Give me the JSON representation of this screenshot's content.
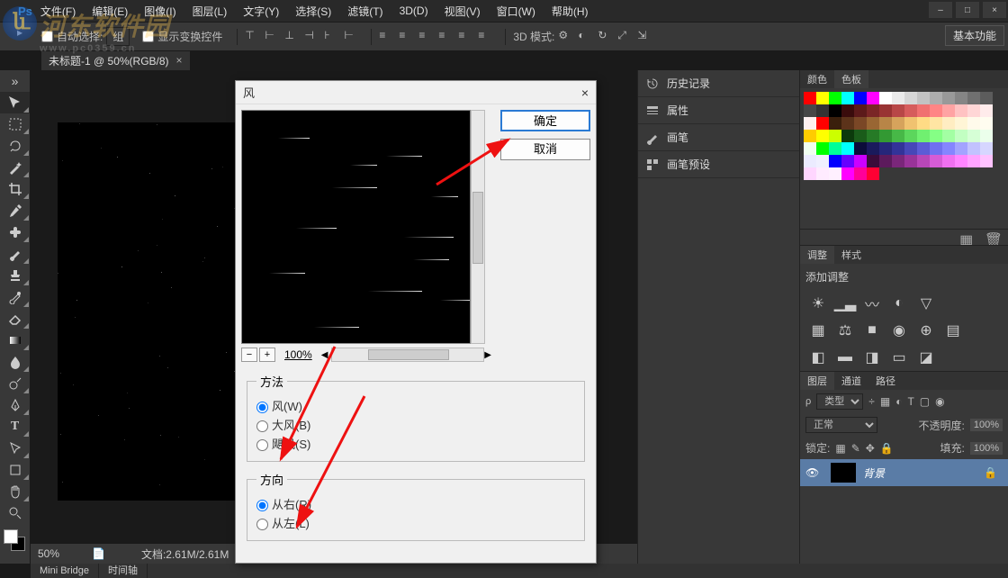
{
  "menu": {
    "items": [
      "文件(F)",
      "编辑(E)",
      "图像(I)",
      "图层(L)",
      "文字(Y)",
      "选择(S)",
      "滤镜(T)",
      "3D(D)",
      "视图(V)",
      "窗口(W)",
      "帮助(H)"
    ]
  },
  "window_controls": {
    "min": "–",
    "max": "□",
    "close": "×"
  },
  "options_bar": {
    "auto_select": "自动选择:",
    "group": "组",
    "show_transform": "显示变换控件",
    "mode_3d": "3D 模式:",
    "right_button": "基本功能"
  },
  "doc_tab": {
    "title": "未标题-1 @ 50%(RGB/8)",
    "close": "×"
  },
  "toolbox_tools": [
    "move",
    "marquee",
    "lasso",
    "wand",
    "crop",
    "eyedropper",
    "heal",
    "brush",
    "stamp",
    "history",
    "eraser",
    "gradient",
    "blur",
    "dodge",
    "pen",
    "type",
    "path",
    "rect",
    "hand",
    "zoom"
  ],
  "status": {
    "zoom": "50%",
    "doc": "文档:2.61M/2.61M"
  },
  "bottom_tabs": [
    "Mini Bridge",
    "时间轴"
  ],
  "mid_panels": [
    {
      "icon": "history",
      "label": "历史记录"
    },
    {
      "icon": "properties",
      "label": "属性"
    },
    {
      "icon": "brush",
      "label": "画笔"
    },
    {
      "icon": "brush-presets",
      "label": "画笔预设"
    }
  ],
  "right": {
    "color_tabs": [
      "颜色",
      "色板"
    ],
    "active_color_tab": 1,
    "swatches": [
      "#ff0000",
      "#ffff00",
      "#00ff00",
      "#00ffff",
      "#0000ff",
      "#ff00ff",
      "#ffffff",
      "#ebebeb",
      "#d6d6d6",
      "#c2c2c2",
      "#adadad",
      "#999999",
      "#858585",
      "#707070",
      "#5c5c5c",
      "#474747",
      "#333333",
      "#000000",
      "#3a0c0c",
      "#5c1a1a",
      "#7a2626",
      "#993333",
      "#b84747",
      "#d65c5c",
      "#f07070",
      "#ff8585",
      "#ffa3a3",
      "#ffc2c2",
      "#ffd6d6",
      "#ffebeb",
      "#fff0f0",
      "#ff0000",
      "#3a1f0c",
      "#5c331a",
      "#7a4726",
      "#996633",
      "#b88547",
      "#d6a35c",
      "#f0c270",
      "#ffdb85",
      "#ffe5a3",
      "#ffedc2",
      "#fff5d6",
      "#fffaeb",
      "#fffdf0",
      "#ffcc00",
      "#ffff00",
      "#ccff00",
      "#0c3a0c",
      "#1a5c1a",
      "#267a26",
      "#339933",
      "#47b847",
      "#5cd65c",
      "#70f070",
      "#85ff85",
      "#a3ffa3",
      "#c2ffc2",
      "#d6ffd6",
      "#ebffeb",
      "#f0fff0",
      "#00ff00",
      "#00ff99",
      "#00ffff",
      "#0c0c3a",
      "#1a1a5c",
      "#26267a",
      "#333399",
      "#4747b8",
      "#5c5cd6",
      "#7070f0",
      "#8585ff",
      "#a3a3ff",
      "#c2c2ff",
      "#d6d6ff",
      "#ebebff",
      "#f0f0ff",
      "#0000ff",
      "#6600ff",
      "#cc00ff",
      "#3a0c3a",
      "#5c1a5c",
      "#7a267a",
      "#993399",
      "#b847b8",
      "#d65cd6",
      "#f070f0",
      "#ff85ff",
      "#ffa3ff",
      "#ffc2ff",
      "#ffd6ff",
      "#ffebff",
      "#fff0ff",
      "#ff00ff",
      "#ff0099",
      "#ff0033"
    ],
    "adjust_tabs": [
      "调整",
      "样式"
    ],
    "adjust_title": "添加调整",
    "layers_tabs": [
      "图层",
      "通道",
      "路径"
    ],
    "layer_kind": "类型",
    "blend_mode": "正常",
    "opacity_label": "不透明度:",
    "opacity_val": "100%",
    "lock_label": "锁定:",
    "fill_label": "填充:",
    "fill_val": "100%",
    "layer_name": "背景"
  },
  "dialog": {
    "title": "风",
    "close": "×",
    "ok": "确定",
    "cancel": "取消",
    "zoom": "100%",
    "method_legend": "方法",
    "method_options": [
      "风(W)",
      "大风(B)",
      "飓风(S)"
    ],
    "method_selected": 0,
    "direction_legend": "方向",
    "direction_options": [
      "从右(R)",
      "从左(L)"
    ],
    "direction_selected": 0
  },
  "watermark": {
    "text": "河东软件园",
    "sub": "www.pc0359.cn"
  }
}
